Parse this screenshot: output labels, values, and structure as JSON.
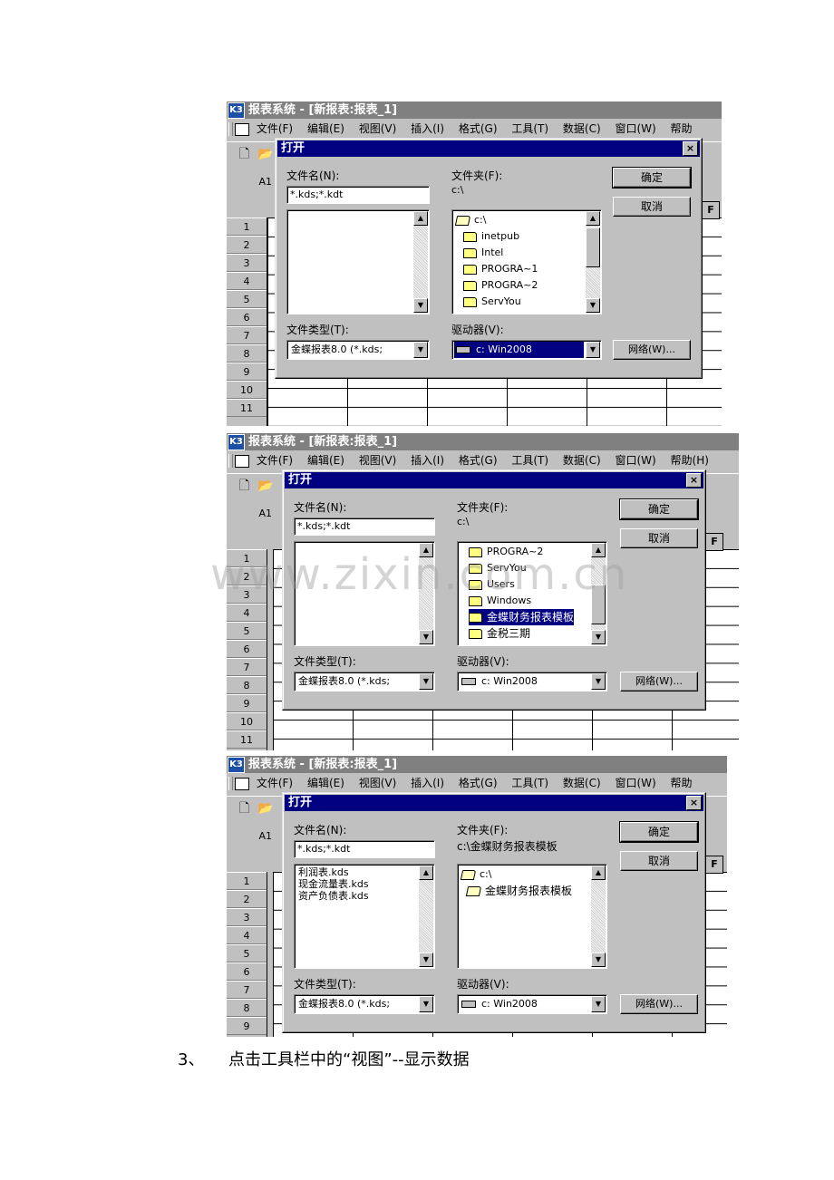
{
  "app": {
    "title": "报表系统 - [新报表:报表_1]",
    "logo": "K3",
    "menu": [
      "文件(F)",
      "编辑(E)",
      "视图(V)",
      "插入(I)",
      "格式(G)",
      "工具(T)",
      "数据(C)",
      "窗口(W)",
      "帮助"
    ],
    "menu_last_alt": "帮助(H)",
    "cell_ref": "A1",
    "col_f": "F",
    "rows": [
      "1",
      "2",
      "3",
      "4",
      "5",
      "6",
      "7",
      "8",
      "9",
      "10",
      "11"
    ]
  },
  "dialog": {
    "title": "打开",
    "close": "×",
    "filename_label": "文件名(N):",
    "filename_value": "*.kds;*.kdt",
    "folder_label": "文件夹(F):",
    "ok": "确定",
    "cancel": "取消",
    "filetype_label": "文件类型(T):",
    "filetype_value": "金蝶报表8.0 (*.kds;",
    "drive_label": "驱动器(V):",
    "drive_value": "c: Win2008",
    "network": "网络(W)..."
  },
  "shots": [
    {
      "folder_path": "c:\\",
      "folders": [
        "c:\\",
        "inetpub",
        "Intel",
        "PROGRA~1",
        "PROGRA~2",
        "ServYou"
      ],
      "files": []
    },
    {
      "folder_path": "c:\\",
      "folders": [
        "PROGRA~2",
        "ServYou",
        "Users",
        "Windows",
        "金蝶财务报表模板",
        "金税三期"
      ],
      "files": []
    },
    {
      "folder_path": "c:\\金蝶财务报表模板",
      "folders": [
        "c:\\",
        "金蝶财务报表模板"
      ],
      "files": [
        "利润表.kds",
        "现金流量表.kds",
        "资产负债表.kds"
      ]
    }
  ],
  "caption": {
    "number": "3、",
    "text": "点击工具栏中的“视图”--显示数据"
  },
  "watermark": "www.zixin.com.cn",
  "colors": {
    "title_active": "#000080",
    "title_inactive": "#808080",
    "face": "#c0c0c0",
    "selection": "#000080"
  }
}
